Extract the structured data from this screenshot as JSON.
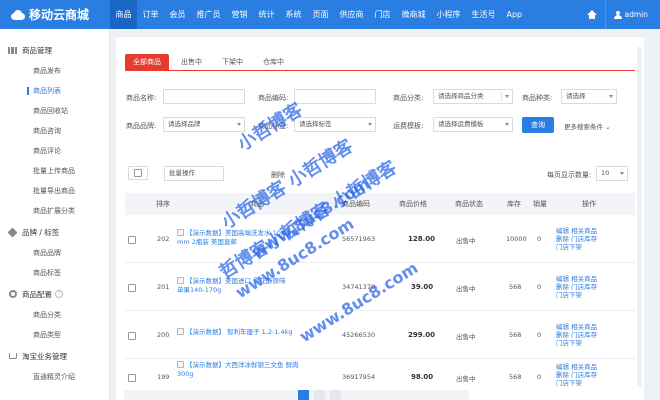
{
  "app": {
    "name": "移动云商城"
  },
  "topnav": [
    "商品",
    "订单",
    "会员",
    "推广员",
    "营销",
    "统计",
    "系统",
    "页面",
    "供应商",
    "门店",
    "微商城",
    "小程序",
    "生活号",
    "App"
  ],
  "user": {
    "name": "admin"
  },
  "sidebar": {
    "groups": [
      {
        "label": "商品管理",
        "items": [
          "商品发布",
          "商品列表",
          "商品回收站",
          "商品咨询",
          "商品评论",
          "批量上传商品",
          "批量导出商品",
          "商品扩展分类"
        ]
      },
      {
        "label": "品牌 / 标签",
        "items": [
          "商品品牌",
          "商品标签"
        ]
      },
      {
        "label": "商品配置",
        "items": [
          "商品分类",
          "商品类型"
        ]
      },
      {
        "label": "淘宝业务管理",
        "items": [
          "直通精灵介绍"
        ]
      }
    ]
  },
  "tabs": [
    "全部商品",
    "出售中",
    "下架中",
    "仓库中"
  ],
  "filters": {
    "name_label": "商品名称:",
    "code_label": "商品编码:",
    "category_label": "商品分类:",
    "category_placeholder": "请选择商品分类",
    "type_label": "商品种类:",
    "type_placeholder": "请选择",
    "brand_label": "商品品牌:",
    "brand_placeholder": "请选择品牌",
    "tag_label": "商品标签:",
    "tag_placeholder": "请选择标签",
    "freight_label": "运费模板:",
    "freight_placeholder": "请选择运费模板",
    "search_button": "查询",
    "more_conditions": "更多搜索条件 ⌄"
  },
  "toolbar": {
    "batch_label": "批量操作",
    "delete_label": "删除",
    "page_size_label": "每页显示数量:",
    "page_size_value": "10"
  },
  "table": {
    "headers": [
      "排序",
      "商品",
      "商品编码",
      "商品价格",
      "商品状态",
      "库存",
      "销量",
      "操作"
    ],
    "rows": [
      {
        "sort": "202",
        "name_l1": "【演示数据】美国高端洗发水 10R 280",
        "name_l2": "mm 2瓶装 美国直邮",
        "code": "56571963",
        "price": "128.00",
        "status": "出售中",
        "stock": "10000",
        "sales": "0",
        "ops": [
          "编辑",
          "相关商品",
          "删除",
          "门店库存",
          "门店下架"
        ]
      },
      {
        "sort": "201",
        "name_l1": "【演示数据】美国进口 雪花酥原味",
        "name_l2": "单果140-170g",
        "code": "34741370",
        "price": "39.00",
        "status": "出售中",
        "stock": "568",
        "sales": "0",
        "ops": [
          "编辑",
          "相关商品",
          "删除",
          "门店库存",
          "门店下架"
        ]
      },
      {
        "sort": "200",
        "name_l1": "【演示数据】 智利车厘子 1.2-1.4kg",
        "name_l2": "",
        "code": "45266530",
        "price": "299.00",
        "status": "出售中",
        "stock": "568",
        "sales": "0",
        "ops": [
          "编辑",
          "相关商品",
          "删除",
          "门店库存",
          "门店下架"
        ]
      },
      {
        "sort": "199",
        "name_l1": "【演示数据】大西洋冰鲜银三文鱼 鲜肉",
        "name_l2": "300g",
        "code": "36917954",
        "price": "98.00",
        "status": "出售中",
        "stock": "568",
        "sales": "0",
        "ops": [
          "编辑",
          "相关商品",
          "删除",
          "门店库存",
          "门店下架"
        ]
      }
    ]
  },
  "watermark": [
    "小哲博客",
    "小哲博客 小哲博客",
    "哲博客小哲博客 小哲博客",
    "www.8uc8.com",
    "www.8uc8.com",
    "www.8uc8.com"
  ],
  "colors": {
    "topbar": "#2a7de1",
    "accent": "#e63b2e",
    "link": "#2a7de1",
    "watermark": "#2864e6"
  }
}
